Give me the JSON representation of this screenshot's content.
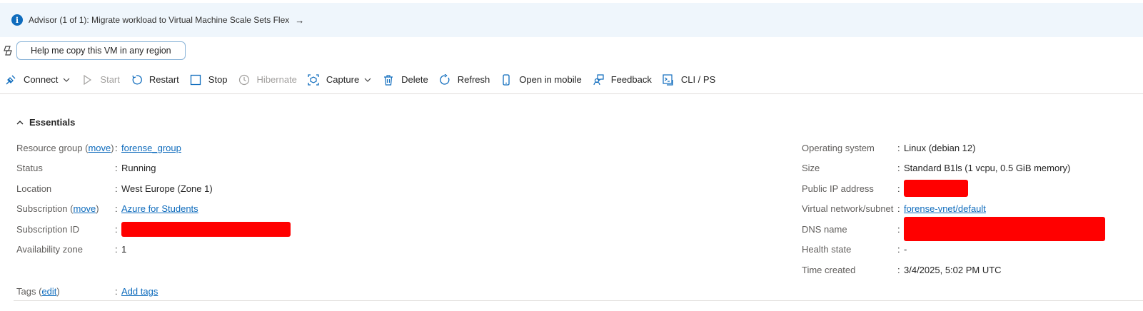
{
  "advisor": {
    "text": "Advisor (1 of 1): Migrate workload to Virtual Machine Scale Sets Flex",
    "arrow": "→",
    "info_glyph": "i"
  },
  "copilot": {
    "prompt": "Help me copy this VM in any region"
  },
  "toolbar": {
    "connect": "Connect",
    "start": "Start",
    "restart": "Restart",
    "stop": "Stop",
    "hibernate": "Hibernate",
    "capture": "Capture",
    "delete": "Delete",
    "refresh": "Refresh",
    "open_mobile": "Open in mobile",
    "feedback": "Feedback",
    "cli": "CLI / PS"
  },
  "essentials": {
    "title": "Essentials",
    "left": {
      "resource_group_label": "Resource group (",
      "resource_group_move": "move",
      "resource_group_label_end": ")",
      "resource_group_value": "forense_group",
      "status_label": "Status",
      "status_value": "Running",
      "location_label": "Location",
      "location_value": "West Europe (Zone 1)",
      "subscription_label": "Subscription (",
      "subscription_move": "move",
      "subscription_label_end": ")",
      "subscription_value": "Azure for Students",
      "subscription_id_label": "Subscription ID",
      "availability_zone_label": "Availability zone",
      "availability_zone_value": "1"
    },
    "right": {
      "os_label": "Operating system",
      "os_value": "Linux (debian 12)",
      "size_label": "Size",
      "size_value": "Standard B1ls (1 vcpu, 0.5 GiB memory)",
      "public_ip_label": "Public IP address",
      "vnet_label": "Virtual network/subnet",
      "vnet_value": "forense-vnet/default",
      "dns_label": "DNS name",
      "health_label": "Health state",
      "health_value": "-",
      "time_label": "Time created",
      "time_value": "3/4/2025, 5:02 PM UTC"
    },
    "tags_label": "Tags (",
    "tags_edit": "edit",
    "tags_label_end": ")",
    "tags_value": "Add tags",
    "separator": ":"
  },
  "colors": {
    "accent": "#0f6cbd",
    "advisor_bg": "#eff6fc",
    "redaction": "#ff0000"
  }
}
